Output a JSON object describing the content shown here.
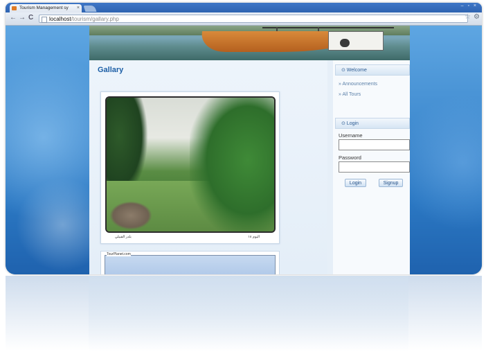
{
  "browser": {
    "tab_title": "Tourism Management sy",
    "tab_close": "×",
    "window_controls": "– ▫ ×",
    "back": "←",
    "forward": "→",
    "reload": "C",
    "url_host": "localhost",
    "url_path": "/tourism/gallary.php",
    "star": "☆",
    "menu": "⚙"
  },
  "page": {
    "title": "Gallary",
    "gallery": {
      "caption_left": "بلدر القبيلي",
      "caption_right": "اليوم ١٨",
      "second_frame_label": "TourPlanet.com"
    }
  },
  "sidebar": {
    "welcome_heading": "⊙ Welcome",
    "links": [
      {
        "label": "» Announcements"
      },
      {
        "label": "» All Tours"
      }
    ],
    "login_heading": "⊙ Login",
    "username_label": "Username",
    "password_label": "Password",
    "login_button": "Login",
    "signup_button": "Signup"
  },
  "colors": {
    "accent": "#1c5fa6",
    "background": "#2b78c3"
  },
  "icons": [
    "favicon-icon",
    "page-icon",
    "star-icon",
    "wrench-icon",
    "boat-image",
    "gallery-photo"
  ]
}
